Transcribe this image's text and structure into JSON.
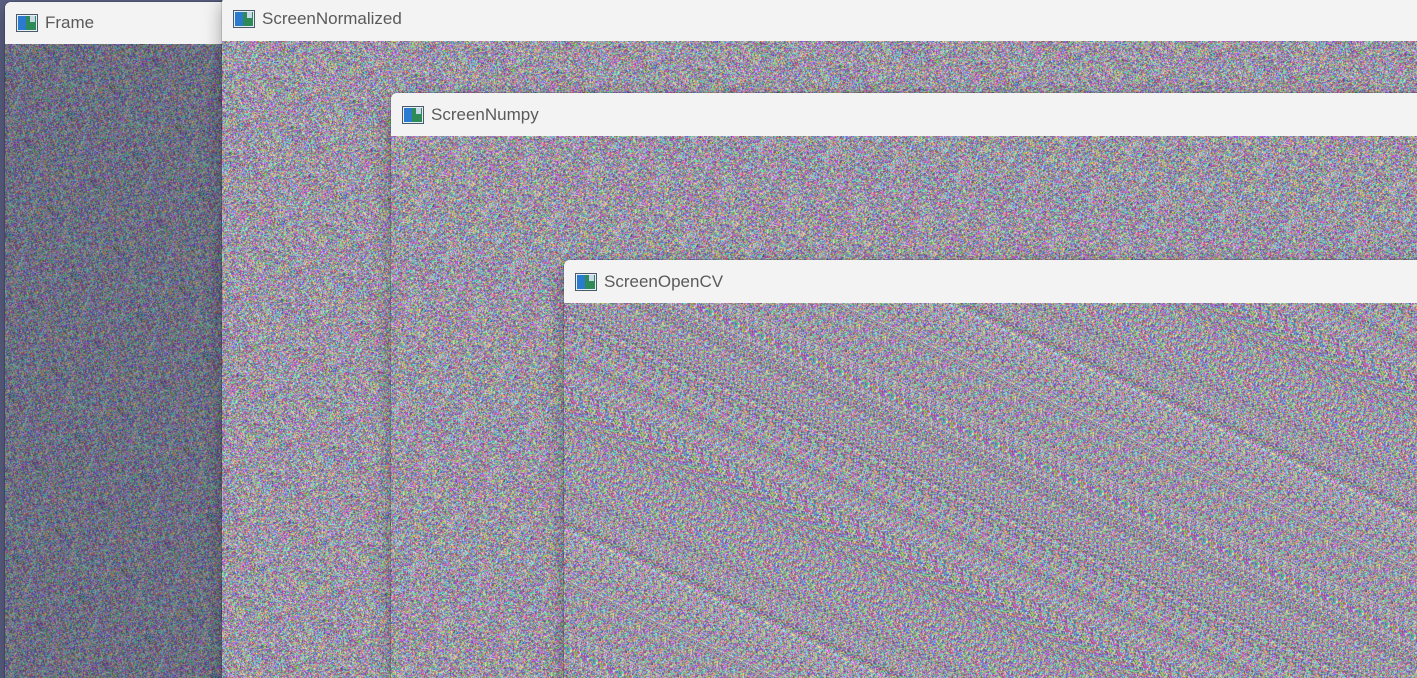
{
  "windows": [
    {
      "id": "frame",
      "title": "Frame",
      "icon": "image-window-icon"
    },
    {
      "id": "normalized",
      "title": "ScreenNormalized",
      "icon": "image-window-icon"
    },
    {
      "id": "numpy",
      "title": "ScreenNumpy",
      "icon": "image-window-icon"
    },
    {
      "id": "opencv",
      "title": "ScreenOpenCV",
      "icon": "image-window-icon"
    }
  ],
  "content": {
    "type": "random-color-noise",
    "frame_tint": "#5a5f86"
  }
}
